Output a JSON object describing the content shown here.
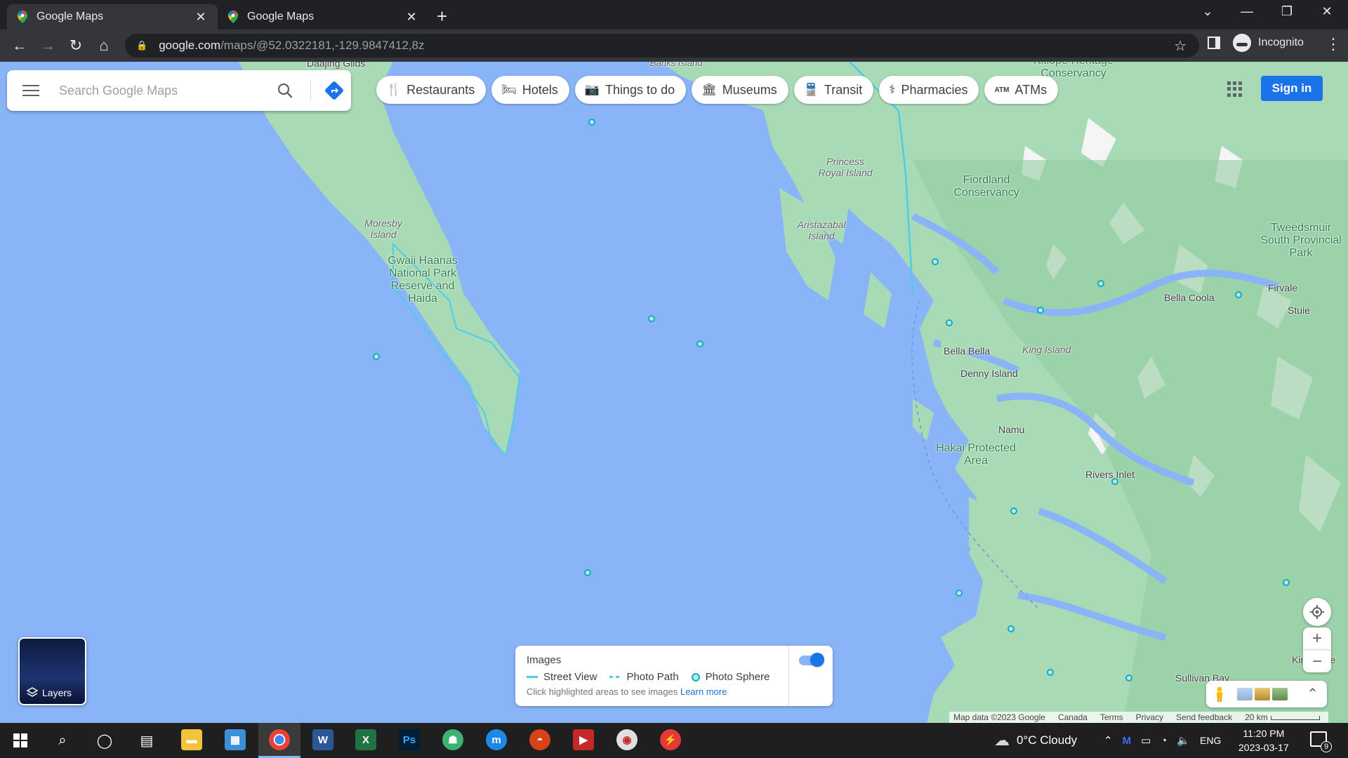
{
  "browser": {
    "tabs": [
      {
        "title": "Google Maps",
        "active": true
      },
      {
        "title": "Google Maps",
        "active": false
      }
    ],
    "url_host": "google.com",
    "url_path": "/maps/@52.0322181,-129.9847412,8z",
    "profile_label": "Incognito"
  },
  "maps": {
    "search_placeholder": "Search Google Maps",
    "chips": [
      {
        "label": "Restaurants",
        "icon": "fork-knife-icon"
      },
      {
        "label": "Hotels",
        "icon": "bed-icon"
      },
      {
        "label": "Things to do",
        "icon": "camera-icon"
      },
      {
        "label": "Museums",
        "icon": "museum-icon"
      },
      {
        "label": "Transit",
        "icon": "bus-icon"
      },
      {
        "label": "Pharmacies",
        "icon": "pharmacy-icon"
      },
      {
        "label": "ATMs",
        "icon": "atm-icon"
      }
    ],
    "sign_in_label": "Sign in",
    "layers_label": "Layers",
    "images_panel": {
      "title": "Images",
      "legend": [
        "Street View",
        "Photo Path",
        "Photo Sphere"
      ],
      "hint": "Click highlighted areas to see images",
      "learn_more": "Learn more",
      "toggle_on": true
    },
    "footer": {
      "map_data": "Map data ©2023 Google",
      "country": "Canada",
      "terms": "Terms",
      "privacy": "Privacy",
      "feedback": "Send feedback",
      "scale": "20 km"
    },
    "places": [
      {
        "name": "Haida Gwaii",
        "text": "Daajing Giids"
      },
      {
        "name": "moresby",
        "text": "Moresby Island"
      },
      {
        "name": "gwaii-haanas",
        "text": "Gwaii Haanas National Park Reserve and Haida"
      },
      {
        "name": "banks",
        "text": "Banks Island"
      },
      {
        "name": "kitlope",
        "text": "Kitlope Heritage Conservancy"
      },
      {
        "name": "princess-royal",
        "text": "Princess Royal Island"
      },
      {
        "name": "aristazabal",
        "text": "Aristazabal Island"
      },
      {
        "name": "fiordland",
        "text": "Fiordland Conservancy"
      },
      {
        "name": "tweedsmuir",
        "text": "Tweedsmuir South Provincial Park"
      },
      {
        "name": "bella-coola",
        "text": "Bella Coola"
      },
      {
        "name": "firvale",
        "text": "Firvale"
      },
      {
        "name": "stuie",
        "text": "Stuie"
      },
      {
        "name": "bella-bella",
        "text": "Bella Bella"
      },
      {
        "name": "king-island",
        "text": "King Island"
      },
      {
        "name": "denny-island",
        "text": "Denny Island"
      },
      {
        "name": "namu",
        "text": "Namu"
      },
      {
        "name": "hakai",
        "text": "Hakai Protected Area"
      },
      {
        "name": "rivers-inlet",
        "text": "Rivers Inlet"
      },
      {
        "name": "kingcome",
        "text": "Kingcome"
      },
      {
        "name": "sullivan-bay",
        "text": "Sullivan Bay"
      }
    ]
  },
  "taskbar": {
    "weather": "0°C  Cloudy",
    "language": "ENG",
    "time": "11:20 PM",
    "date": "2023-03-17",
    "notifications": "9"
  },
  "colors": {
    "water": "#8ab4f8",
    "land": "#a8dab5",
    "accent": "#1a73e8"
  }
}
